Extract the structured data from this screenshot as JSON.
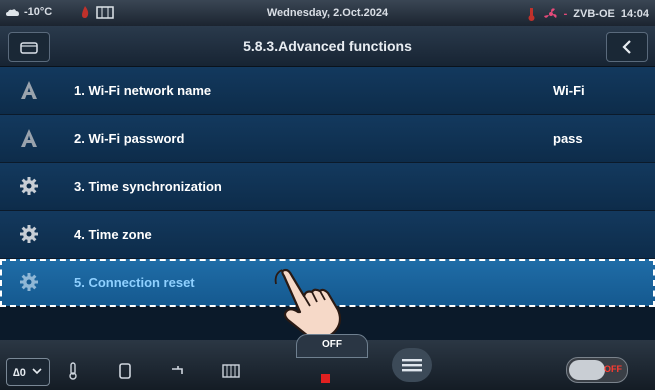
{
  "status": {
    "temperature": "-10°C",
    "date": "Wednesday, 2.Oct.2024",
    "controller": "ZVB-OE",
    "time": "14:04"
  },
  "header": {
    "title": "5.8.3.Advanced functions"
  },
  "menu": {
    "items": [
      {
        "label": "1. Wi-Fi network name",
        "value": "Wi-Fi",
        "icon": "letter-a-icon"
      },
      {
        "label": "2. Wi-Fi password",
        "value": "pass",
        "icon": "letter-a-icon"
      },
      {
        "label": "3. Time synchronization",
        "value": "",
        "icon": "gear-icon"
      },
      {
        "label": "4. Time zone",
        "value": "",
        "icon": "gear-icon"
      },
      {
        "label": "5. Connection reset",
        "value": "",
        "icon": "gear-icon"
      }
    ],
    "selected_index": 4
  },
  "bottom": {
    "off_label": "OFF",
    "toggle_label": "OFF"
  },
  "colors": {
    "row_bg": "#0d2c4a",
    "row_selected_bg": "#15598f",
    "accent_red": "#e02020"
  }
}
